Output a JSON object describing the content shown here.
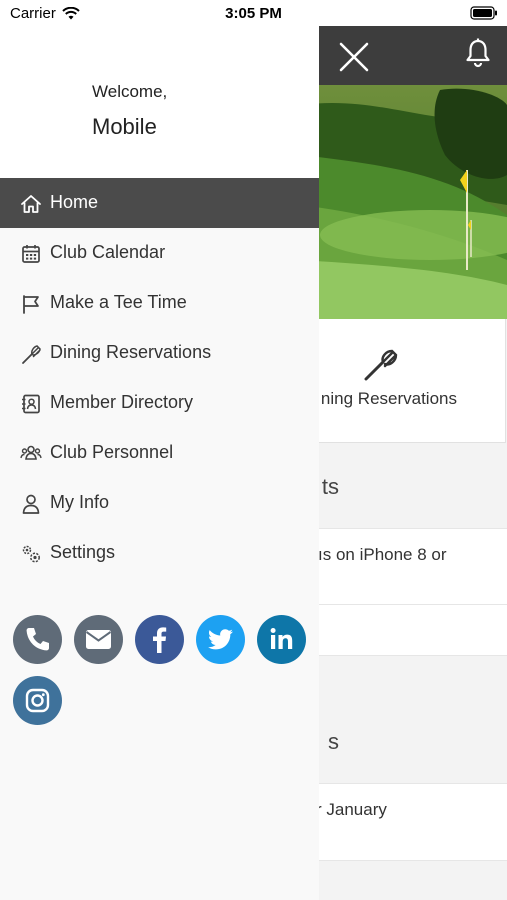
{
  "status_bar": {
    "carrier": "Carrier",
    "time": "3:05 PM"
  },
  "header": {
    "close_icon": "close-icon",
    "bell_icon": "bell-icon",
    "background_color": "#3d3d3d"
  },
  "background": {
    "quick_link_label": "ning Reservations",
    "section1_heading": "ts",
    "news1_text": "ıs on iPhone 8 or",
    "section2_heading": "s",
    "news2_text": "r January"
  },
  "drawer": {
    "welcome_label": "Welcome,",
    "user_name": "Mobile",
    "menu": [
      {
        "label": "Home",
        "icon": "home-icon",
        "active": true
      },
      {
        "label": "Club Calendar",
        "icon": "calendar-icon",
        "active": false
      },
      {
        "label": "Make a Tee Time",
        "icon": "flag-icon",
        "active": false
      },
      {
        "label": "Dining Reservations",
        "icon": "fork-icon",
        "active": false
      },
      {
        "label": "Member Directory",
        "icon": "directory-icon",
        "active": false
      },
      {
        "label": "Club Personnel",
        "icon": "personnel-icon",
        "active": false
      },
      {
        "label": "My Info",
        "icon": "user-icon",
        "active": false
      },
      {
        "label": "Settings",
        "icon": "gears-icon",
        "active": false
      }
    ],
    "social": [
      {
        "name": "phone-icon",
        "color": "#5f6b78"
      },
      {
        "name": "email-icon",
        "color": "#5f6b78"
      },
      {
        "name": "facebook-icon",
        "color": "#3b5998"
      },
      {
        "name": "twitter-icon",
        "color": "#1da1f2"
      },
      {
        "name": "linkedin-icon",
        "color": "#0e76a8"
      },
      {
        "name": "instagram-icon",
        "color": "#3f729b"
      }
    ]
  }
}
